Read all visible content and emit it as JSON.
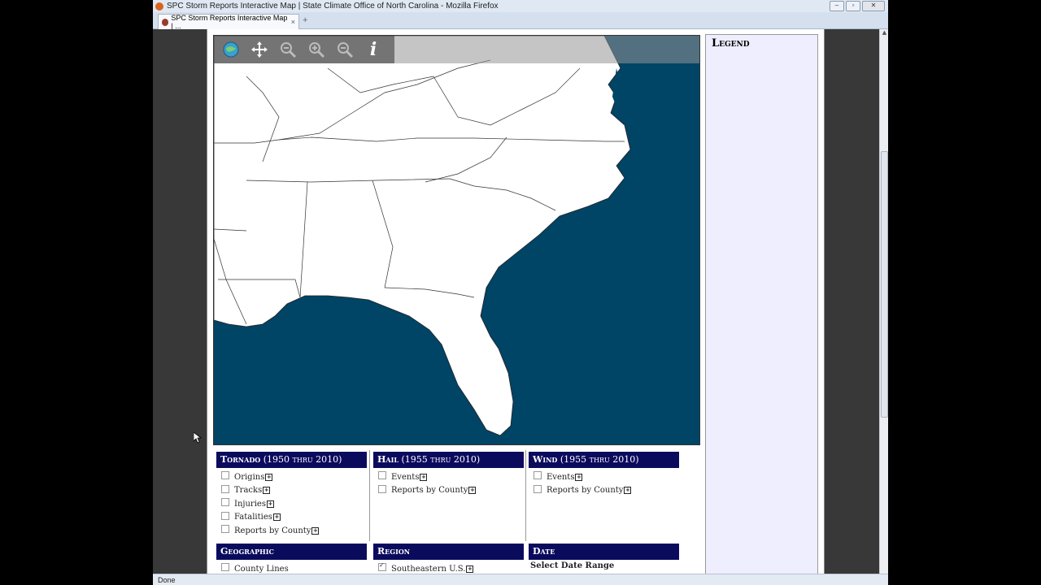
{
  "window": {
    "title": "SPC Storm Reports Interactive Map | State Climate Office of North Carolina - Mozilla Firefox"
  },
  "tab": {
    "label": "SPC Storm Reports Interactive Map | ...",
    "new_tab": "+"
  },
  "toolbar": {
    "tools": [
      "globe-icon",
      "pan-icon",
      "zoom-out-box-icon",
      "zoom-in-icon",
      "zoom-out-icon",
      "info-icon"
    ],
    "info_glyph": "i"
  },
  "map": {
    "ocean_color": "#004466",
    "land_color": "#ffffff"
  },
  "legend": {
    "title": "Legend"
  },
  "panels": {
    "tornado": {
      "title": "Tornado",
      "range": "(1950 thru 2010)",
      "items": [
        "Origins",
        "Tracks",
        "Injuries",
        "Fatalities",
        "Reports by County"
      ]
    },
    "hail": {
      "title": "Hail",
      "range": "(1955 thru 2010)",
      "items": [
        "Events",
        "Reports by County"
      ]
    },
    "wind": {
      "title": "Wind",
      "range": "(1955 thru 2010)",
      "items": [
        "Events",
        "Reports by County"
      ]
    },
    "geographic": {
      "title": "Geographic",
      "items": [
        "County Lines"
      ]
    },
    "region": {
      "title": "Region",
      "items": [
        "Southeastern U.S."
      ]
    },
    "date": {
      "title": "Date",
      "label": "Select Date Range"
    }
  },
  "status": {
    "text": "Done"
  }
}
